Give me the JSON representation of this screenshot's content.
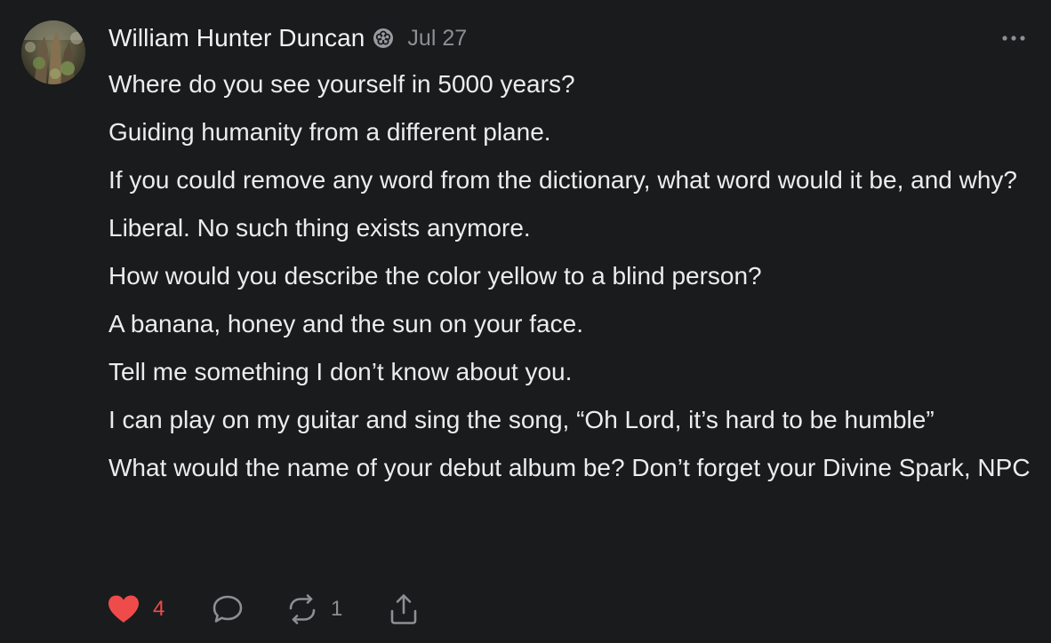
{
  "post": {
    "author": {
      "name": "William Hunter Duncan",
      "badge_icon": "founding-member-badge-icon",
      "avatar_icon": "profile-photo-avatar"
    },
    "date": "Jul 27",
    "more_icon": "more-dots-icon",
    "paragraphs": [
      "Where do you see yourself in 5000 years?",
      "Guiding humanity from a different plane.",
      "If you could remove any word from the dictionary, what word would it be, and why?",
      "Liberal. No such thing exists anymore.",
      "How would you describe the color yellow to a blind person?",
      "A banana, honey and the sun on your face.",
      "Tell me something I don’t know about you.",
      "I can play on my guitar and sing the song, “Oh Lord, it’s hard to be humble”",
      "What would the name of your debut album be? Don’t forget your Divine Spark, NPC"
    ],
    "actions": {
      "like": {
        "icon": "heart-icon",
        "count": "4",
        "liked": true
      },
      "comment": {
        "icon": "comment-icon"
      },
      "restack": {
        "icon": "restack-icon",
        "count": "1"
      },
      "share": {
        "icon": "share-icon"
      }
    }
  },
  "colors": {
    "background": "#1a1b1d",
    "text": "#ececec",
    "muted": "#8e8e93",
    "like": "#ef4b4b"
  }
}
